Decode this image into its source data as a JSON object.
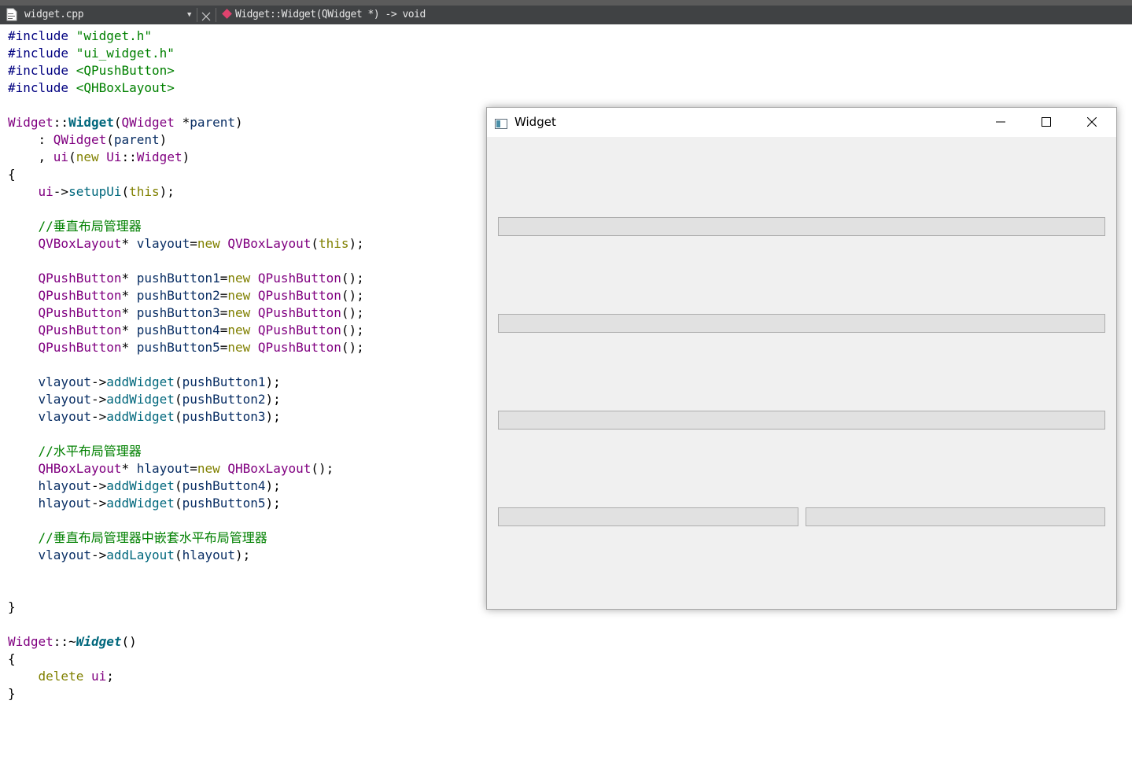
{
  "toolbar": {
    "file_name": "widget.cpp",
    "dropdown_glyph": "▼",
    "symbol": "Widget::Widget(QWidget *) -> void"
  },
  "code_lines": [
    [
      [
        "pp",
        "#include "
      ],
      [
        "str",
        "\"widget.h\""
      ]
    ],
    [
      [
        "pp",
        "#include "
      ],
      [
        "str",
        "\"ui_widget.h\""
      ]
    ],
    [
      [
        "pp",
        "#include "
      ],
      [
        "str",
        "<QPushButton>"
      ]
    ],
    [
      [
        "pp",
        "#include "
      ],
      [
        "str",
        "<QHBoxLayout>"
      ]
    ],
    [],
    [
      [
        "ty",
        "Widget"
      ],
      [
        "pl",
        "::"
      ],
      [
        "fnb",
        "Widget"
      ],
      [
        "pl",
        "("
      ],
      [
        "ty",
        "QWidget"
      ],
      [
        "pl",
        " *"
      ],
      [
        "ident",
        "parent"
      ],
      [
        "pl",
        ")"
      ]
    ],
    [
      [
        "pl",
        "    : "
      ],
      [
        "ty",
        "QWidget"
      ],
      [
        "pl",
        "("
      ],
      [
        "ident",
        "parent"
      ],
      [
        "pl",
        ")"
      ]
    ],
    [
      [
        "pl",
        "    , "
      ],
      [
        "ty",
        "ui"
      ],
      [
        "pl",
        "("
      ],
      [
        "kw",
        "new"
      ],
      [
        "pl",
        " "
      ],
      [
        "ty",
        "Ui"
      ],
      [
        "pl",
        "::"
      ],
      [
        "ty",
        "Widget"
      ],
      [
        "pl",
        ")"
      ]
    ],
    [
      [
        "pl",
        "{"
      ]
    ],
    [
      [
        "pl",
        "    "
      ],
      [
        "ty",
        "ui"
      ],
      [
        "pl",
        "->"
      ],
      [
        "fn",
        "setupUi"
      ],
      [
        "pl",
        "("
      ],
      [
        "kw",
        "this"
      ],
      [
        "pl",
        ");"
      ]
    ],
    [],
    [
      [
        "cm",
        "    //垂直布局管理器"
      ]
    ],
    [
      [
        "pl",
        "    "
      ],
      [
        "ty",
        "QVBoxLayout"
      ],
      [
        "pl",
        "* "
      ],
      [
        "ident",
        "vlayout"
      ],
      [
        "pl",
        "="
      ],
      [
        "kw",
        "new"
      ],
      [
        "pl",
        " "
      ],
      [
        "ty",
        "QVBoxLayout"
      ],
      [
        "pl",
        "("
      ],
      [
        "kw",
        "this"
      ],
      [
        "pl",
        ");"
      ]
    ],
    [],
    [
      [
        "pl",
        "    "
      ],
      [
        "ty",
        "QPushButton"
      ],
      [
        "pl",
        "* "
      ],
      [
        "ident",
        "pushButton1"
      ],
      [
        "pl",
        "="
      ],
      [
        "kw",
        "new"
      ],
      [
        "pl",
        " "
      ],
      [
        "ty",
        "QPushButton"
      ],
      [
        "pl",
        "();"
      ]
    ],
    [
      [
        "pl",
        "    "
      ],
      [
        "ty",
        "QPushButton"
      ],
      [
        "pl",
        "* "
      ],
      [
        "ident",
        "pushButton2"
      ],
      [
        "pl",
        "="
      ],
      [
        "kw",
        "new"
      ],
      [
        "pl",
        " "
      ],
      [
        "ty",
        "QPushButton"
      ],
      [
        "pl",
        "();"
      ]
    ],
    [
      [
        "pl",
        "    "
      ],
      [
        "ty",
        "QPushButton"
      ],
      [
        "pl",
        "* "
      ],
      [
        "ident",
        "pushButton3"
      ],
      [
        "pl",
        "="
      ],
      [
        "kw",
        "new"
      ],
      [
        "pl",
        " "
      ],
      [
        "ty",
        "QPushButton"
      ],
      [
        "pl",
        "();"
      ]
    ],
    [
      [
        "pl",
        "    "
      ],
      [
        "ty",
        "QPushButton"
      ],
      [
        "pl",
        "* "
      ],
      [
        "ident",
        "pushButton4"
      ],
      [
        "pl",
        "="
      ],
      [
        "kw",
        "new"
      ],
      [
        "pl",
        " "
      ],
      [
        "ty",
        "QPushButton"
      ],
      [
        "pl",
        "();"
      ]
    ],
    [
      [
        "pl",
        "    "
      ],
      [
        "ty",
        "QPushButton"
      ],
      [
        "pl",
        "* "
      ],
      [
        "ident",
        "pushButton5"
      ],
      [
        "pl",
        "="
      ],
      [
        "kw",
        "new"
      ],
      [
        "pl",
        " "
      ],
      [
        "ty",
        "QPushButton"
      ],
      [
        "pl",
        "();"
      ]
    ],
    [],
    [
      [
        "pl",
        "    "
      ],
      [
        "ident",
        "vlayout"
      ],
      [
        "pl",
        "->"
      ],
      [
        "fn",
        "addWidget"
      ],
      [
        "pl",
        "("
      ],
      [
        "ident",
        "pushButton1"
      ],
      [
        "pl",
        ");"
      ]
    ],
    [
      [
        "pl",
        "    "
      ],
      [
        "ident",
        "vlayout"
      ],
      [
        "pl",
        "->"
      ],
      [
        "fn",
        "addWidget"
      ],
      [
        "pl",
        "("
      ],
      [
        "ident",
        "pushButton2"
      ],
      [
        "pl",
        ");"
      ]
    ],
    [
      [
        "pl",
        "    "
      ],
      [
        "ident",
        "vlayout"
      ],
      [
        "pl",
        "->"
      ],
      [
        "fn",
        "addWidget"
      ],
      [
        "pl",
        "("
      ],
      [
        "ident",
        "pushButton3"
      ],
      [
        "pl",
        ");"
      ]
    ],
    [],
    [
      [
        "cm",
        "    //水平布局管理器"
      ]
    ],
    [
      [
        "pl",
        "    "
      ],
      [
        "ty",
        "QHBoxLayout"
      ],
      [
        "pl",
        "* "
      ],
      [
        "ident",
        "hlayout"
      ],
      [
        "pl",
        "="
      ],
      [
        "kw",
        "new"
      ],
      [
        "pl",
        " "
      ],
      [
        "ty",
        "QHBoxLayout"
      ],
      [
        "pl",
        "();"
      ]
    ],
    [
      [
        "pl",
        "    "
      ],
      [
        "ident",
        "hlayout"
      ],
      [
        "pl",
        "->"
      ],
      [
        "fn",
        "addWidget"
      ],
      [
        "pl",
        "("
      ],
      [
        "ident",
        "pushButton4"
      ],
      [
        "pl",
        ");"
      ]
    ],
    [
      [
        "pl",
        "    "
      ],
      [
        "ident",
        "hlayout"
      ],
      [
        "pl",
        "->"
      ],
      [
        "fn",
        "addWidget"
      ],
      [
        "pl",
        "("
      ],
      [
        "ident",
        "pushButton5"
      ],
      [
        "pl",
        ");"
      ]
    ],
    [],
    [
      [
        "cm",
        "    //垂直布局管理器中嵌套水平布局管理器"
      ]
    ],
    [
      [
        "pl",
        "    "
      ],
      [
        "ident",
        "vlayout"
      ],
      [
        "pl",
        "->"
      ],
      [
        "fn",
        "addLayout"
      ],
      [
        "pl",
        "("
      ],
      [
        "ident",
        "hlayout"
      ],
      [
        "pl",
        ");"
      ]
    ],
    [],
    [],
    [
      [
        "pl",
        "}"
      ]
    ],
    [],
    [
      [
        "ty",
        "Widget"
      ],
      [
        "pl",
        "::~"
      ],
      [
        "fnbi",
        "Widget"
      ],
      [
        "pl",
        "()"
      ]
    ],
    [
      [
        "pl",
        "{"
      ]
    ],
    [
      [
        "pl",
        "    "
      ],
      [
        "kw",
        "delete"
      ],
      [
        "pl",
        " "
      ],
      [
        "ty",
        "ui"
      ],
      [
        "pl",
        ";"
      ]
    ],
    [
      [
        "pl",
        "}"
      ]
    ]
  ],
  "qt_window": {
    "title": "Widget",
    "buttons": [
      {
        "name": "pushButton1",
        "label": ""
      },
      {
        "name": "pushButton2",
        "label": ""
      },
      {
        "name": "pushButton3",
        "label": ""
      },
      {
        "name": "pushButton4",
        "label": ""
      },
      {
        "name": "pushButton5",
        "label": ""
      }
    ]
  },
  "colors": {
    "toolbar_bg": "#404244",
    "preprocessor": "#000080",
    "string": "#008000",
    "type": "#800080",
    "function": "#00677c",
    "keyword": "#808000",
    "comment": "#008000",
    "window_bg": "#f0f0f0",
    "button_bg": "#e1e1e1"
  }
}
